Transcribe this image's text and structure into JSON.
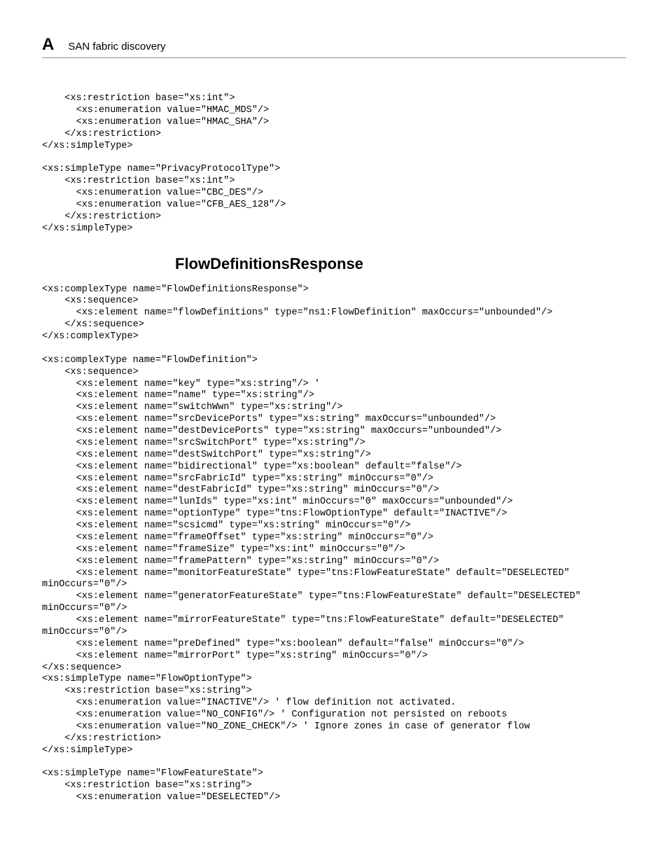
{
  "header": {
    "appendix_letter": "A",
    "title": "SAN fabric discovery"
  },
  "code_block_1": "    <xs:restriction base=\"xs:int\">\n      <xs:enumeration value=\"HMAC_MDS\"/>\n      <xs:enumeration value=\"HMAC_SHA\"/>\n    </xs:restriction>\n</xs:simpleType>\n\n<xs:simpleType name=\"PrivacyProtocolType\">\n    <xs:restriction base=\"xs:int\">\n      <xs:enumeration value=\"CBC_DES\"/>\n      <xs:enumeration value=\"CFB_AES_128\"/>\n    </xs:restriction>\n</xs:simpleType>",
  "section": {
    "heading": "FlowDefinitionsResponse"
  },
  "code_block_2": "<xs:complexType name=\"FlowDefinitionsResponse\">\n    <xs:sequence>\n      <xs:element name=\"flowDefinitions\" type=\"ns1:FlowDefinition\" maxOccurs=\"unbounded\"/>\n    </xs:sequence>\n</xs:complexType>\n\n<xs:complexType name=\"FlowDefinition\">\n    <xs:sequence>\n      <xs:element name=\"key\" type=\"xs:string\"/> '\n      <xs:element name=\"name\" type=\"xs:string\"/>\n      <xs:element name=\"switchWwn\" type=\"xs:string\"/>\n      <xs:element name=\"srcDevicePorts\" type=\"xs:string\" maxOccurs=\"unbounded\"/>\n      <xs:element name=\"destDevicePorts\" type=\"xs:string\" maxOccurs=\"unbounded\"/>\n      <xs:element name=\"srcSwitchPort\" type=\"xs:string\"/>\n      <xs:element name=\"destSwitchPort\" type=\"xs:string\"/>\n      <xs:element name=\"bidirectional\" type=\"xs:boolean\" default=\"false\"/>\n      <xs:element name=\"srcFabricId\" type=\"xs:string\" minOccurs=\"0\"/>\n      <xs:element name=\"destFabricId\" type=\"xs:string\" minOccurs=\"0\"/>\n      <xs:element name=\"lunIds\" type=\"xs:int\" minOccurs=\"0\" maxOccurs=\"unbounded\"/>\n      <xs:element name=\"optionType\" type=\"tns:FlowOptionType\" default=\"INACTIVE\"/>\n      <xs:element name=\"scsicmd\" type=\"xs:string\" minOccurs=\"0\"/>\n      <xs:element name=\"frameOffset\" type=\"xs:string\" minOccurs=\"0\"/>\n      <xs:element name=\"frameSize\" type=\"xs:int\" minOccurs=\"0\"/>\n      <xs:element name=\"framePattern\" type=\"xs:string\" minOccurs=\"0\"/>\n      <xs:element name=\"monitorFeatureState\" type=\"tns:FlowFeatureState\" default=\"DESELECTED\" \nminOccurs=\"0\"/>\n      <xs:element name=\"generatorFeatureState\" type=\"tns:FlowFeatureState\" default=\"DESELECTED\" \nminOccurs=\"0\"/>\n      <xs:element name=\"mirrorFeatureState\" type=\"tns:FlowFeatureState\" default=\"DESELECTED\" \nminOccurs=\"0\"/>\n      <xs:element name=\"preDefined\" type=\"xs:boolean\" default=\"false\" minOccurs=\"0\"/>\n      <xs:element name=\"mirrorPort\" type=\"xs:string\" minOccurs=\"0\"/>\n</xs:sequence>\n<xs:simpleType name=\"FlowOptionType\">\n    <xs:restriction base=\"xs:string\">\n      <xs:enumeration value=\"INACTIVE\"/> ' flow definition not activated.\n      <xs:enumeration value=\"NO_CONFIG\"/> ' Configuration not persisted on reboots\n      <xs:enumeration value=\"NO_ZONE_CHECK\"/> ' Ignore zones in case of generator flow\n    </xs:restriction>\n</xs:simpleType>\n\n<xs:simpleType name=\"FlowFeatureState\">\n    <xs:restriction base=\"xs:string\">\n      <xs:enumeration value=\"DESELECTED\"/>"
}
